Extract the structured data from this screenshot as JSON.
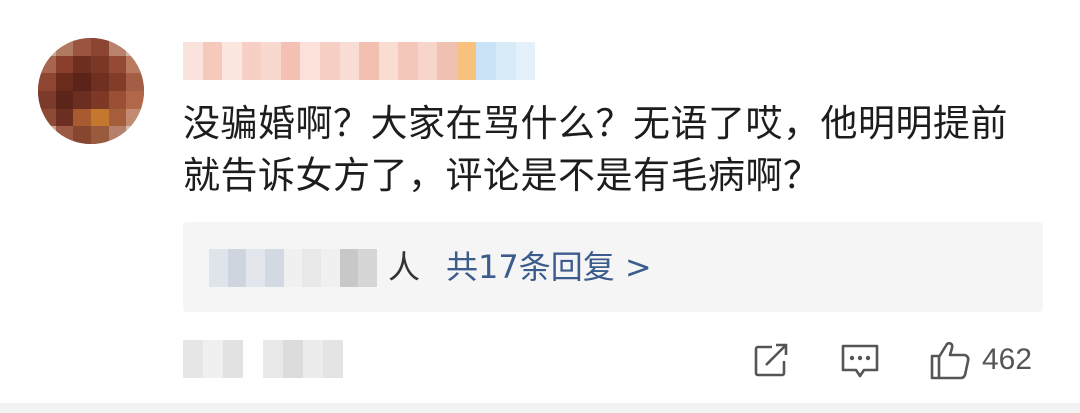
{
  "comment": {
    "text": "没骗婚啊？大家在骂什么？无语了哎，他明明提前就告诉女方了，评论是不是有毛病啊？"
  },
  "replies": {
    "person_suffix": "人",
    "count_label": "共17条回复 >"
  },
  "actions": {
    "share_icon": "share-icon",
    "comment_icon": "comment-icon",
    "like_icon": "thumbs-up-icon",
    "like_count": "462"
  },
  "colors": {
    "link": "#3c5c8e",
    "reply_bg": "#f5f5f5",
    "text": "#1d1d1d"
  }
}
